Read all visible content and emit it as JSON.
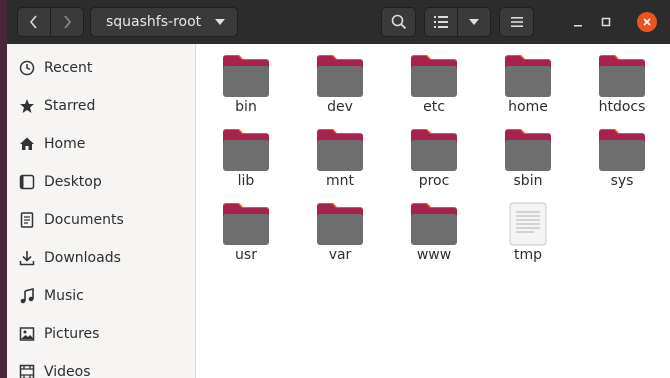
{
  "header": {
    "path_label": "squashfs-root",
    "back_icon": "chevron-left-icon",
    "forward_icon": "chevron-right-icon",
    "close_color": "#e95420"
  },
  "sidebar": {
    "items": [
      {
        "label": "Recent",
        "icon": "clock-icon"
      },
      {
        "label": "Starred",
        "icon": "star-icon"
      },
      {
        "label": "Home",
        "icon": "home-icon"
      },
      {
        "label": "Desktop",
        "icon": "desktop-icon"
      },
      {
        "label": "Documents",
        "icon": "document-icon"
      },
      {
        "label": "Downloads",
        "icon": "download-icon"
      },
      {
        "label": "Music",
        "icon": "music-icon"
      },
      {
        "label": "Pictures",
        "icon": "picture-icon"
      },
      {
        "label": "Videos",
        "icon": "video-icon"
      }
    ]
  },
  "files": [
    {
      "name": "bin",
      "type": "folder"
    },
    {
      "name": "dev",
      "type": "folder"
    },
    {
      "name": "etc",
      "type": "folder"
    },
    {
      "name": "home",
      "type": "folder"
    },
    {
      "name": "htdocs",
      "type": "folder"
    },
    {
      "name": "lib",
      "type": "folder"
    },
    {
      "name": "mnt",
      "type": "folder"
    },
    {
      "name": "proc",
      "type": "folder"
    },
    {
      "name": "sbin",
      "type": "folder"
    },
    {
      "name": "sys",
      "type": "folder"
    },
    {
      "name": "usr",
      "type": "folder"
    },
    {
      "name": "var",
      "type": "folder"
    },
    {
      "name": "www",
      "type": "folder"
    },
    {
      "name": "tmp",
      "type": "text-file"
    }
  ],
  "colors": {
    "folder_tab": "#e95420",
    "folder_accent": "#a5234d",
    "folder_body": "#6e6e6e",
    "header_bg": "#2c2c2c"
  }
}
